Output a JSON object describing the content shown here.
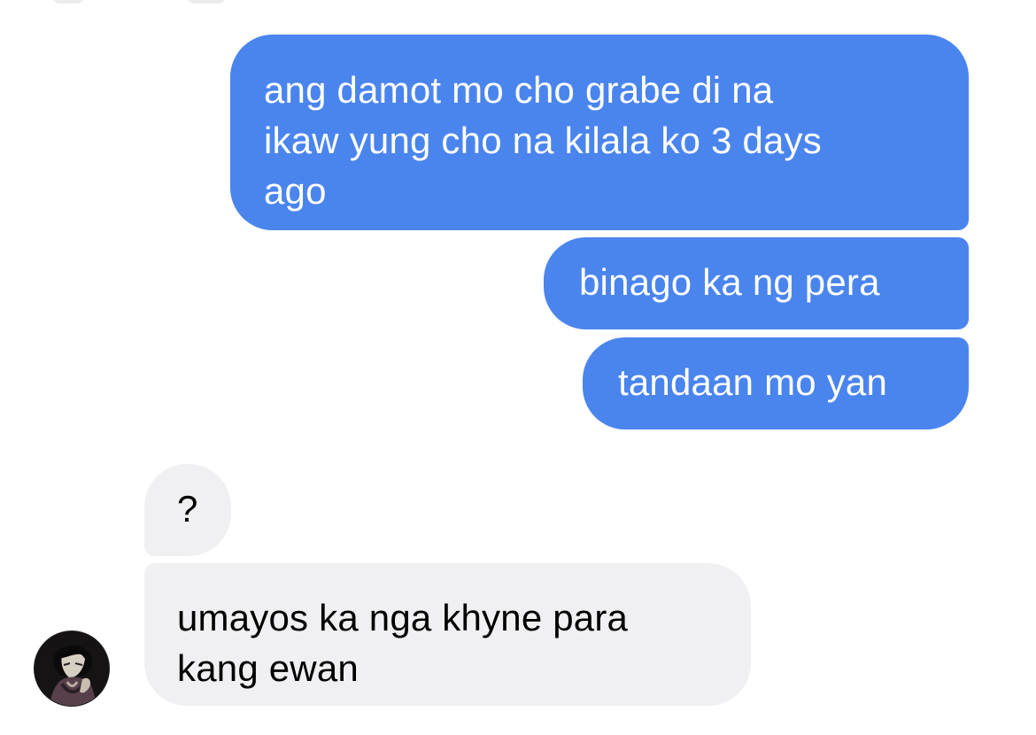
{
  "conversation": {
    "messages": [
      {
        "side": "outgoing",
        "lines": [
          "ang damot mo cho grabe di na",
          "ikaw yung cho na kilala ko 3 days",
          "ago"
        ]
      },
      {
        "side": "outgoing",
        "lines": [
          "binago ka ng pera"
        ]
      },
      {
        "side": "outgoing",
        "lines": [
          "tandaan mo yan"
        ]
      },
      {
        "side": "incoming",
        "lines": [
          "?"
        ]
      },
      {
        "side": "incoming",
        "lines": [
          "umayos ka nga khyne para",
          "kang ewan"
        ]
      }
    ]
  },
  "avatar": {
    "type": "profile-avatar"
  },
  "colors": {
    "outgoing_bubble": "#4a85ee",
    "incoming_bubble": "#f0f0f2",
    "background": "#ffffff"
  }
}
